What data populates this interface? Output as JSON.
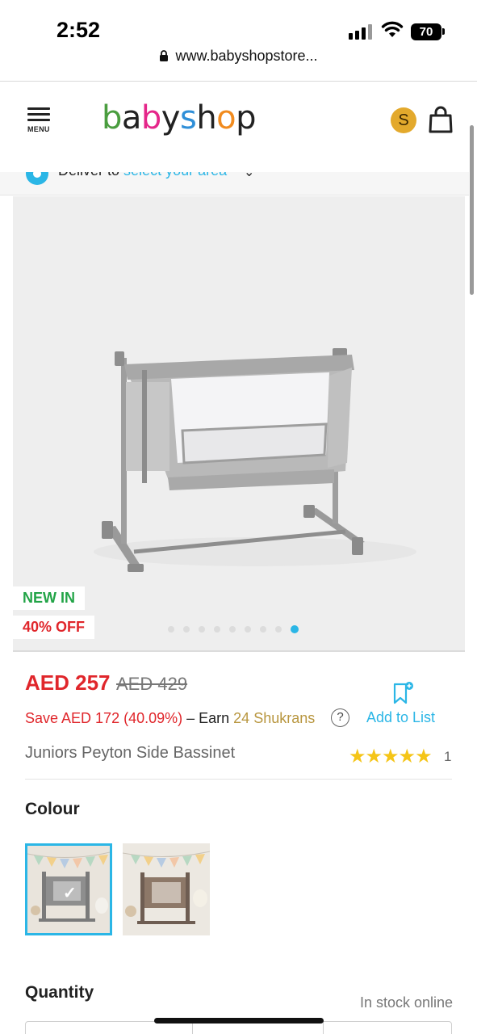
{
  "status_bar": {
    "time": "2:52",
    "battery": "70"
  },
  "browser": {
    "url": "www.babyshopstore..."
  },
  "header": {
    "menu_label": "MENU",
    "logo_letters": [
      "b",
      "a",
      "b",
      "y",
      "s",
      "h",
      "o",
      "p"
    ],
    "logo_colors": [
      "#4a9d3f",
      "#222222",
      "#e5268a",
      "#222222",
      "#2f8fd8",
      "#222222",
      "#f18b1e",
      "#222222"
    ],
    "shukran_initial": "S"
  },
  "deliver": {
    "label": "Deliver to",
    "area_link": "select your area"
  },
  "gallery": {
    "badges": [
      "NEW IN",
      "40% OFF"
    ],
    "slide_count": 9,
    "active_slide": 8
  },
  "product": {
    "price_now": "AED 257",
    "price_was": "AED 429",
    "save_text": "Save AED 172 (40.09%)",
    "earn_text": " – Earn ",
    "shukrans_text": "24 Shukrans",
    "help_symbol": "?",
    "add_to_list": "Add to List",
    "name": "Juniors Peyton Side Bassinet",
    "stars": "★★★★★",
    "rating_count": "1"
  },
  "colour": {
    "title": "Colour",
    "swatches": [
      "grey",
      "brown"
    ],
    "selected": 0
  },
  "quantity": {
    "title": "Quantity",
    "stock_status": "In stock online"
  },
  "colors": {
    "accent": "#2bb6e6",
    "sale": "#e0262b",
    "new": "#22a447",
    "shukran": "#b8963f",
    "star": "#f5c518"
  }
}
